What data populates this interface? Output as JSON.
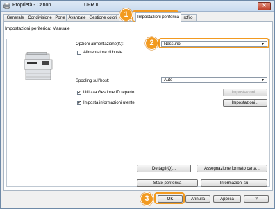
{
  "window": {
    "title": "Proprietà - Canon",
    "title_tail": "UFR II",
    "close": "✕"
  },
  "tabs": [
    "Generale",
    "Condivisione",
    "Porte",
    "Avanzate",
    "Gestione colori",
    "Impostazioni periferica",
    "rofilo"
  ],
  "panel_caption": "Impostazioni periferica: Manuale",
  "feed_label": "Opzioni alimentazione(K):",
  "feed_value": "Nessuno",
  "envelope_label": "Alimentatore di buste",
  "spooling_label": "Spooling sull'host:",
  "spooling_value": "Auto",
  "dept_label": "Utilizza Gestione ID reparto",
  "user_label": "Imposta informazioni utente",
  "settings_btn_1": "Impostazioni...",
  "settings_btn_2": "Impostazioni...",
  "details_btn": "Dettagli(Q)...",
  "paper_assign_btn": "Assegnazione formato carta...",
  "device_status_btn": "Stato periferica",
  "info_btn": "Informazioni su",
  "ok": "OK",
  "cancel": "Annulla",
  "apply": "Applica",
  "help": "?",
  "callouts": {
    "b1": "1",
    "b2": "2",
    "b3": "3"
  },
  "colors": {
    "callout": "#f29a20",
    "title_gradient_top": "#dfe9f5",
    "close_red": "#c0412a"
  },
  "checks": {
    "envelope": false,
    "dept": true,
    "user": true
  },
  "check_mark": "✓"
}
